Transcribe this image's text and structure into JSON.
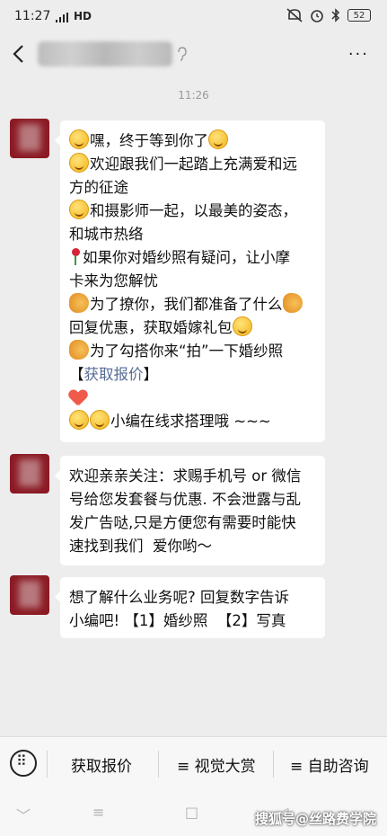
{
  "status_bar": {
    "time": "11:27",
    "network": "HD",
    "battery": "52"
  },
  "header": {
    "more": "···"
  },
  "timestamp": "11:26",
  "messages": [
    {
      "lines": [
        "嘿，终于等到你了",
        "欢迎跟我们一起踏上充满爱和远",
        "方的征途",
        "和摄影师一起，以最美的姿态，",
        "和城市热络",
        "如果你对婚纱照有疑问，让小摩",
        "卡来为您解忧",
        "为了撩你，我们都准备了什么",
        "回复优惠，获取婚嫁礼包",
        "为了勾搭你来“拍”一下婚纱照",
        "【",
        "获取报价",
        "】",
        "小编在线求搭理哦 ~~~"
      ]
    },
    {
      "lines": [
        "欢迎亲亲关注：求赐手机号 or 微信",
        "号给您发套餐与优惠. 不会泄露与乱",
        "发广告哒,只是方便您有需要时能快",
        "速找到我们  爱你哟～"
      ]
    },
    {
      "lines": [
        "想了解什么业务呢? 回复数字告诉",
        "小编吧! 【1】婚纱照  【2】写真"
      ]
    }
  ],
  "menu": {
    "items": [
      "获取报价",
      "≡ 视觉大赏",
      "≡ 自助咨询"
    ]
  },
  "nav": {
    "back": "﹀",
    "home": "≡",
    "square": "□",
    "triangle": "◁"
  },
  "watermark": "搜狐号@丝路费学院",
  "colors": {
    "background": "#ededed",
    "avatar": "#8b1a24",
    "link": "#576b95"
  }
}
